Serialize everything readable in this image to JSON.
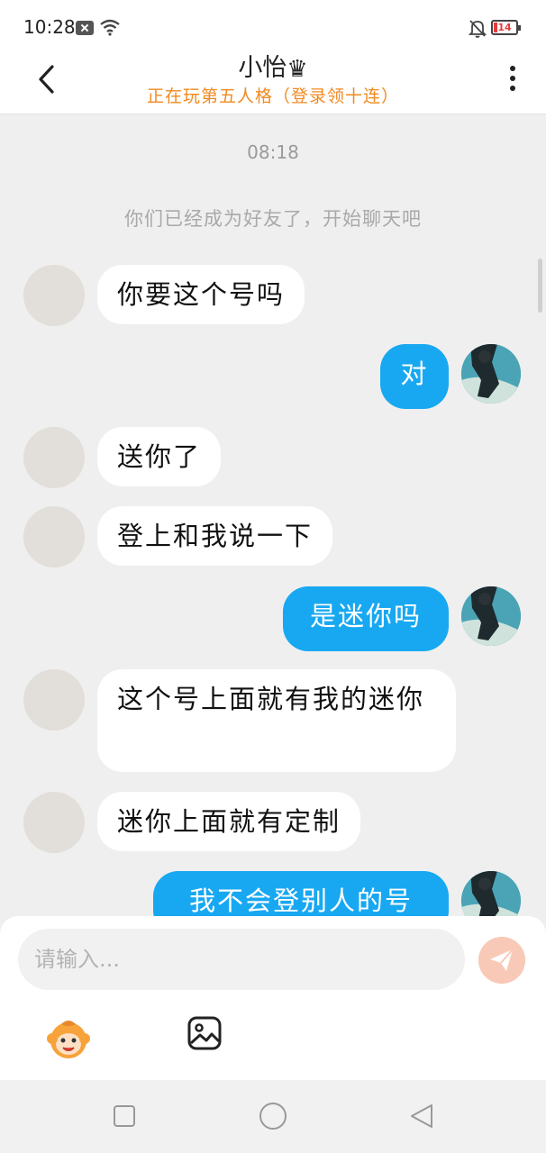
{
  "status_bar": {
    "time": "10:28",
    "battery": "14",
    "icons": [
      "notification-icon",
      "wifi-icon",
      "bell-off-icon",
      "battery-icon"
    ]
  },
  "header": {
    "title": "小怡",
    "crown": "♛",
    "subtitle": "正在玩第五人格（登录领十连）"
  },
  "chat": {
    "timestamp": "08:18",
    "system_message": "你们已经成为好友了，开始聊天吧",
    "messages": [
      {
        "from": "other",
        "text": "你要这个号吗"
      },
      {
        "from": "me",
        "text": "对"
      },
      {
        "from": "other",
        "text": "送你了"
      },
      {
        "from": "other",
        "text": "登上和我说一下"
      },
      {
        "from": "me",
        "text": "是迷你吗"
      },
      {
        "from": "other",
        "text": "这个号上面就有我的迷你"
      },
      {
        "from": "other",
        "text": "迷你上面就有定制"
      },
      {
        "from": "me",
        "text": "我不会登别人的号"
      }
    ]
  },
  "input": {
    "placeholder": "请输入..."
  },
  "colors": {
    "accent_blue": "#18a8f1",
    "subtitle_orange": "#f08a22",
    "send_disabled": "#f9c9b8"
  }
}
